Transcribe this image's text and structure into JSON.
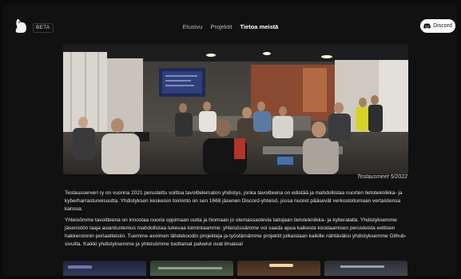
{
  "header": {
    "beta_label": "BETA",
    "nav": [
      {
        "label": "Etusivu",
        "active": false
      },
      {
        "label": "Projektit",
        "active": false
      },
      {
        "label": "Tietoa meistä",
        "active": true
      }
    ],
    "discord_label": "Discord"
  },
  "hero": {
    "caption": "Testausmeet 5/2022"
  },
  "content": {
    "paragraph1": "Testausserveri ry on vuonna 2021 perustettu voittoa tavoittelematon yhdistys, jonka tavoitteena on edistää ja mahdollistaa nuorten tietotekniikka- ja kyberharrastuneisuutta. Yhdistyksen keskeisin toiminto on sen 1668 jäsenen Discord-yhteisö, jossa nuoret pääsevät verkostoitumaan vertaistensa kanssa.",
    "paragraph2": "Yhteisömme tavoitteena on innostaa nuoria oppimaan uutta ja hiomaan jo olemassaolevia taitojaan tietotekniikka- ja kyberalalla. Yhdistyksemme jäsenistön laaja asiantuntemus mahdollistaa tukevaa toimintaamme: yhteisössämme voi saada apua kaikesta koodaamisen perusteista eettisen hakkeroinnin periaatteisiin. Tuemme avoimen lähdekoodin projekteja ja työstämämme projektit julkaistaan kaikille nähtäväksi yhdistyksemme Github-sivuilla. Kaikki yhdistyksemme ja yhteisömme tuottamat palvelut ovat ilmaisia!"
  },
  "colors": {
    "background": "#111111",
    "text": "#e8e8e8",
    "discord_button": "#ffffff"
  },
  "icons": [
    "mascot-logo-icon",
    "discord-icon"
  ]
}
